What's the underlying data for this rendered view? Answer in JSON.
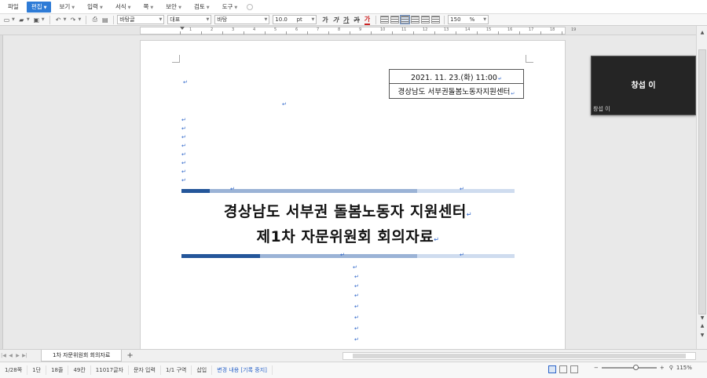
{
  "menu": {
    "file": "파일",
    "edit": "편집",
    "view": "보기",
    "input": "입력",
    "format": "서식",
    "page": "쪽",
    "security": "보안",
    "review": "검토",
    "tools": "도구"
  },
  "toolbar": {
    "style_name": "바탕글",
    "representative": "대표",
    "font_name": "바탕",
    "font_size": "10.0",
    "font_unit": "pt",
    "bold_label": "가",
    "italic_label": "가",
    "underline_label": "가",
    "strike_label": "가",
    "color_label": "가",
    "zoom_value": "150",
    "zoom_unit": "%"
  },
  "ruler": {
    "numbers": [
      "1",
      "2",
      "3",
      "4",
      "5",
      "6",
      "7",
      "8",
      "9",
      "10",
      "11",
      "12",
      "13",
      "14",
      "15",
      "16",
      "17",
      "18",
      "19"
    ]
  },
  "document": {
    "date_line": "2021. 11. 23.(화) 11:00",
    "org_line": "경상남도 서부권돌봄노동자지원센터",
    "title_line1": "경상남도 서부권 돌봄노동자 지원센터",
    "title_line2": "제1차 자문위원회 회의자료",
    "para_mark": "↵"
  },
  "video": {
    "participant_name": "창섭 이",
    "participant_tag": "창섭 이"
  },
  "tabs": {
    "doc_tab": "1차 자문위원회 회의자료",
    "add_tab": "+"
  },
  "status": {
    "page": "1/28쪽",
    "section": "1단",
    "line": "18줄",
    "column": "49칸",
    "chars": "11017글자",
    "input_mode": "문자 입력",
    "zone": "1/1 구역",
    "insert": "삽입",
    "track": "변경 내용 [기록 중지]",
    "zoom": "115%"
  },
  "colors": {
    "accent": "#2e7bd6",
    "band_dark": "#24569a",
    "band_light": "#9bb3d6",
    "para_mark": "#2a63c9"
  }
}
